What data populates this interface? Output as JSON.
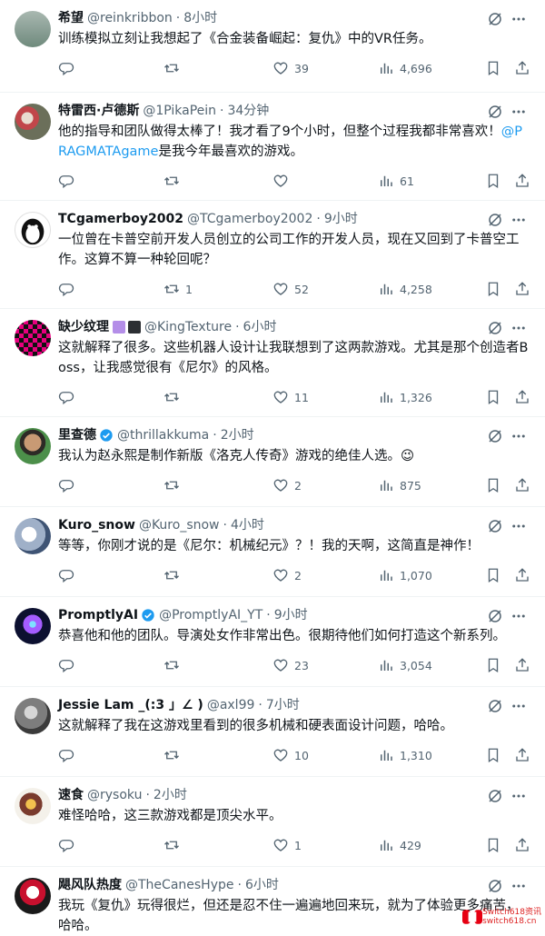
{
  "tweets": [
    {
      "name": "希望",
      "handle": "@reinkribbon",
      "time": "8小时",
      "text": "训练模拟立刻让我想起了《合金装备崛起：复仇》中的VR任务。",
      "replies": "",
      "retweets": "",
      "likes": "39",
      "views": "4,696"
    },
    {
      "name": "特雷西·卢德斯",
      "handle": "@1PikaPein",
      "time": "34分钟",
      "text": "他的指导和团队做得太棒了！我才看了9个小时，但整个过程我都非常喜欢！",
      "mention": "@PRAGMATAgame",
      "text2": "是我今年最喜欢的游戏。",
      "replies": "",
      "retweets": "",
      "likes": "",
      "views": "61"
    },
    {
      "name": "TCgamerboy2002",
      "handle": "@TCgamerboy2002",
      "time": "9小时",
      "text": "一位曾在卡普空前开发人员创立的公司工作的开发人员，现在又回到了卡普空工作。这算不算一种轮回呢？",
      "replies": "",
      "retweets": "1",
      "likes": "52",
      "views": "4,258"
    },
    {
      "name": "缺少纹理",
      "handle": "@KingTexture",
      "time": "6小时",
      "text": "这就解释了很多。这些机器人设计让我联想到了这两款游戏。尤其是那个创造者Boss，让我感觉很有《尼尔》的风格。",
      "replies": "",
      "retweets": "",
      "likes": "11",
      "views": "1,326"
    },
    {
      "name": "里查德",
      "handle": "@thrillakkuma",
      "time": "2小时",
      "text": "我认为赵永熙是制作新版《洛克人传奇》游戏的绝佳人选。😉",
      "replies": "",
      "retweets": "",
      "likes": "2",
      "views": "875"
    },
    {
      "name": "Kuro_snow",
      "handle": "@Kuro_snow",
      "time": "4小时",
      "text": "等等，你刚才说的是《尼尔：机械纪元》？！我的天啊，这简直是神作！",
      "replies": "",
      "retweets": "",
      "likes": "2",
      "views": "1,070"
    },
    {
      "name": "PromptlyAI",
      "handle": "@PromptlyAI_YT",
      "time": "9小时",
      "text": "恭喜他和他的团队。导演处女作非常出色。很期待他们如何打造这个新系列。",
      "replies": "",
      "retweets": "",
      "likes": "23",
      "views": "3,054"
    },
    {
      "name": "Jessie Lam _(:3 」∠ )",
      "handle": "@axl99",
      "time": "7小时",
      "text": "这就解释了我在这游戏里看到的很多机械和硬表面设计问题，哈哈。",
      "replies": "",
      "retweets": "",
      "likes": "10",
      "views": "1,310"
    },
    {
      "name": "速食",
      "handle": "@rysoku",
      "time": "2小时",
      "text": "难怪哈哈，这三款游戏都是顶尖水平。",
      "replies": "",
      "retweets": "",
      "likes": "1",
      "views": "429"
    },
    {
      "name": "飓风队热度",
      "handle": "@TheCanesHype",
      "time": "6小时",
      "text": "我玩《复仇》玩得很烂，但还是忍不住一遍遍地回来玩，就为了体验更多痛苦，哈哈。",
      "replies": "",
      "retweets": "",
      "likes": "",
      "views": ""
    }
  ],
  "watermark": {
    "line1": "Switch618资讯",
    "line2": "switch618.cn"
  },
  "colors": {
    "text": "#0f1419",
    "secondary": "#536471",
    "link": "#1d9bf0",
    "divider": "#eff3f4",
    "verified": "#1d9bf0"
  }
}
